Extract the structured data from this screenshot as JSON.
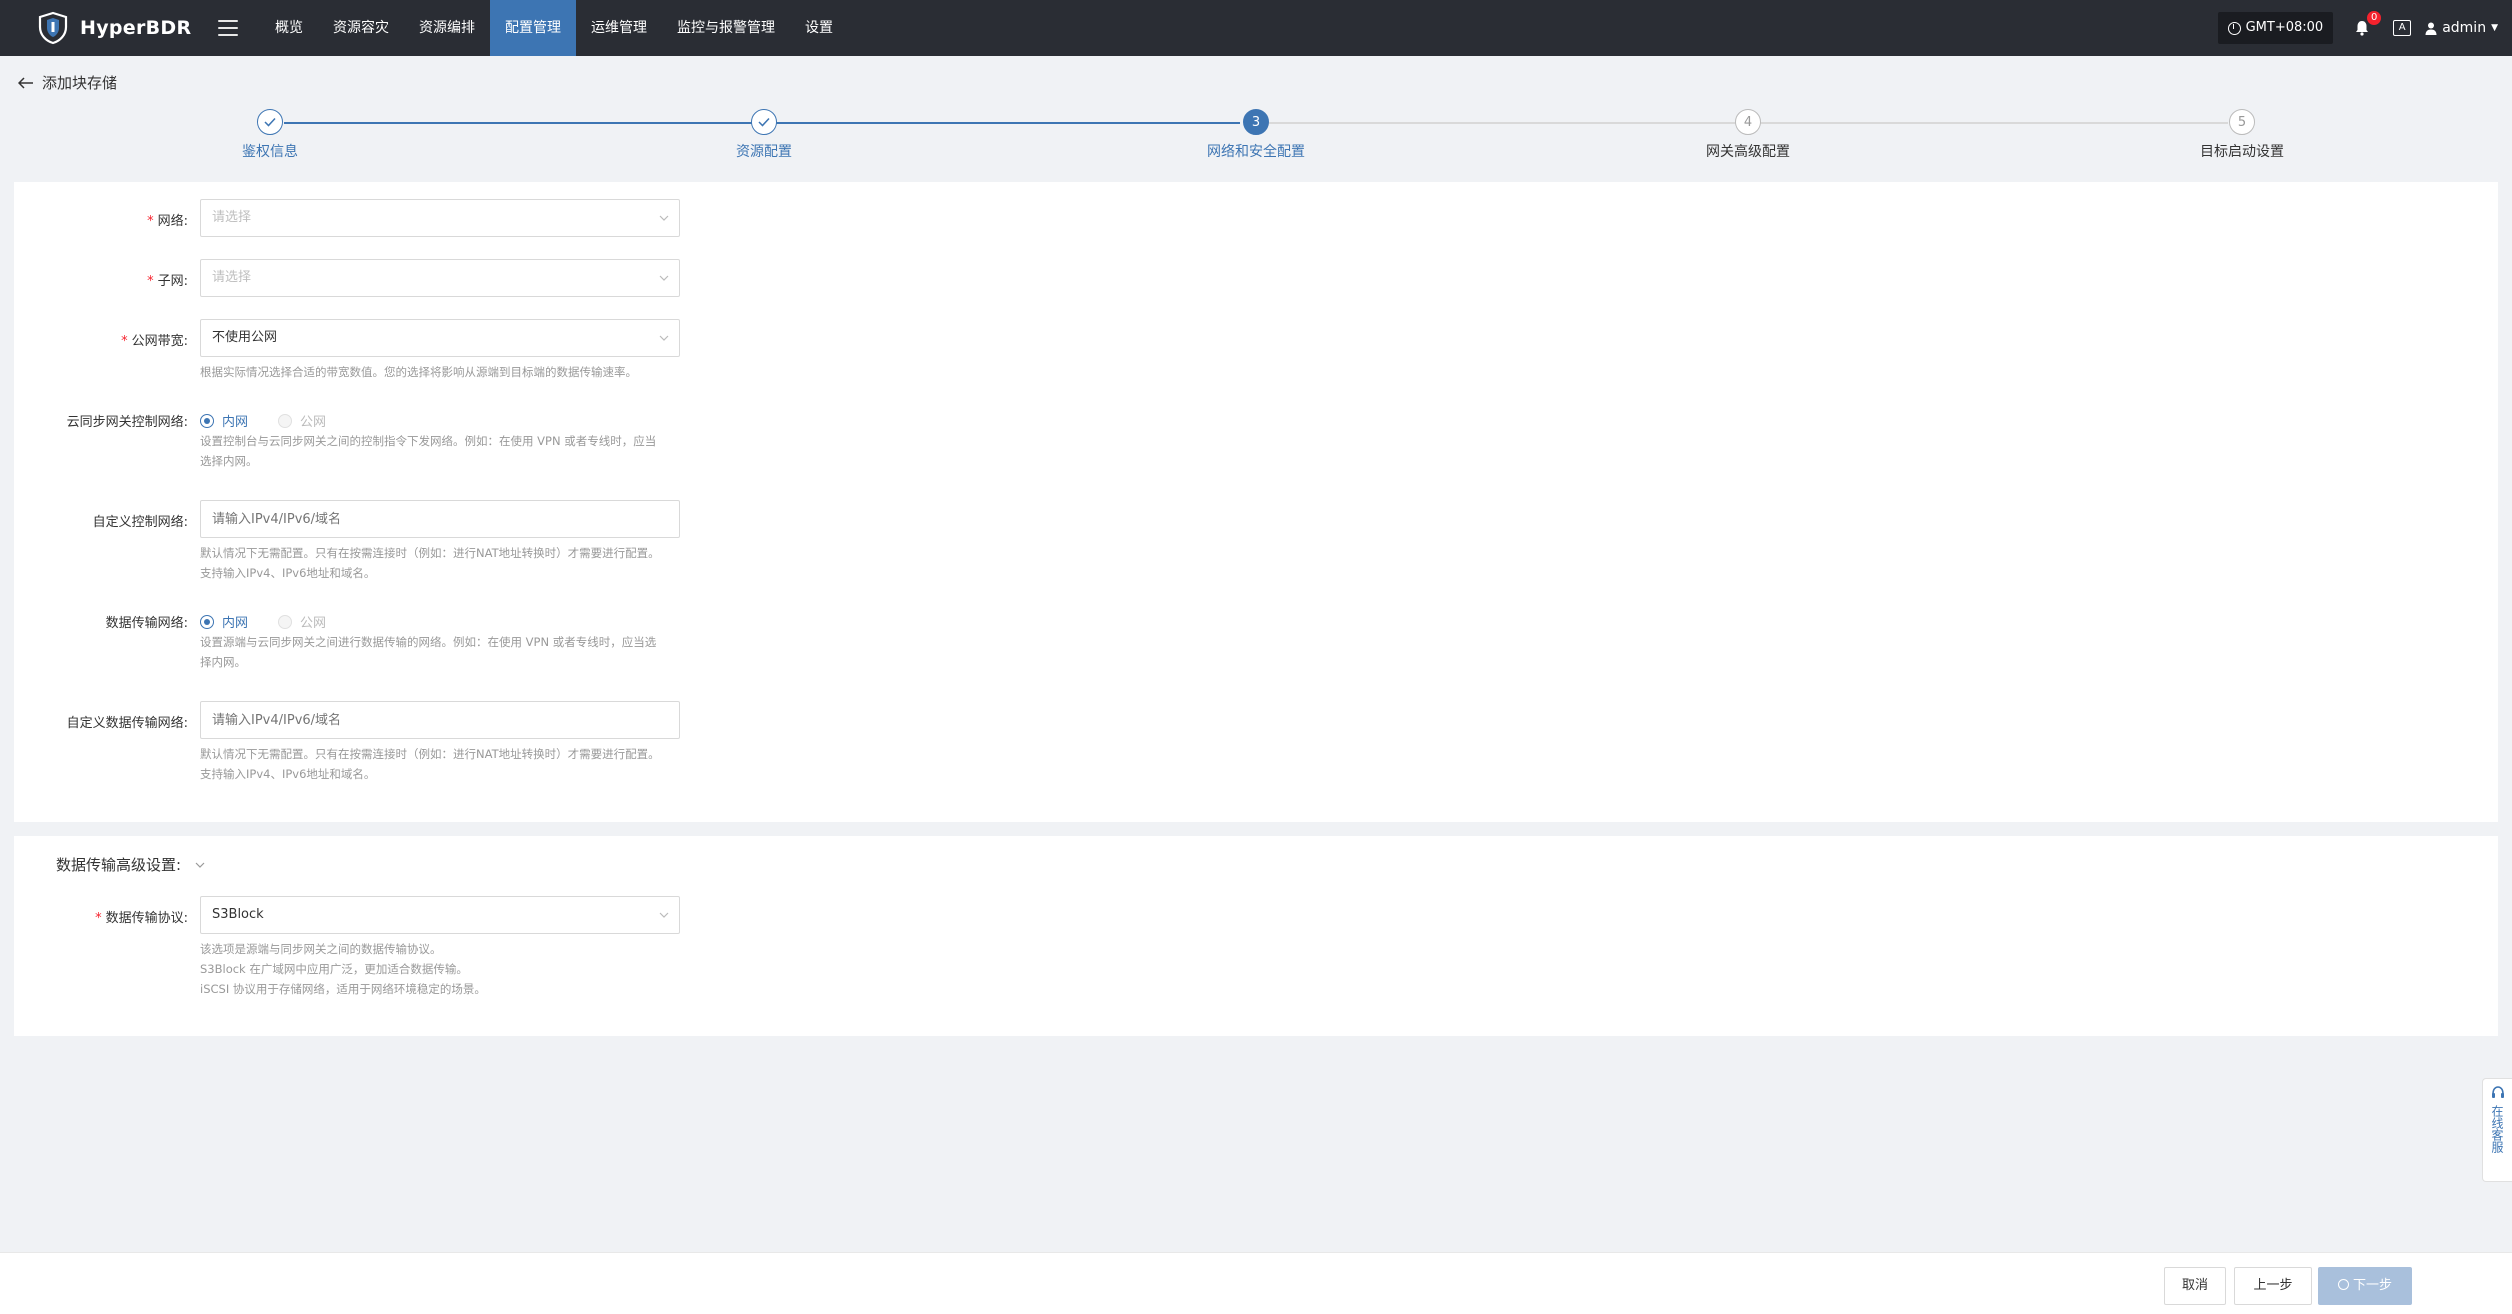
{
  "app": {
    "name": "HyperBDR"
  },
  "nav": {
    "items": [
      "概览",
      "资源容灾",
      "资源编排",
      "配置管理",
      "运维管理",
      "监控与报警管理",
      "设置"
    ],
    "active_index": 3,
    "timezone": "GMT+08:00",
    "notification_count": "0",
    "lang_icon_text": "A",
    "user": "admin"
  },
  "page": {
    "title": "添加块存储"
  },
  "steps": [
    {
      "label": "鉴权信息",
      "status": "done",
      "number": "1"
    },
    {
      "label": "资源配置",
      "status": "done",
      "number": "2"
    },
    {
      "label": "网络和安全配置",
      "status": "current",
      "number": "3"
    },
    {
      "label": "网关高级配置",
      "status": "pending",
      "number": "4"
    },
    {
      "label": "目标启动设置",
      "status": "pending",
      "number": "5"
    }
  ],
  "form": {
    "network": {
      "label": "网络:",
      "placeholder": "请选择"
    },
    "subnet": {
      "label": "子网:",
      "placeholder": "请选择"
    },
    "bandwidth": {
      "label": "公网带宽:",
      "value": "不使用公网",
      "help": "根据实际情况选择合适的带宽数值。您的选择将影响从源端到目标端的数据传输速率。"
    },
    "control_network": {
      "label": "云同步网关控制网络:",
      "options": [
        "内网",
        "公网"
      ],
      "selected": "内网",
      "help_line1": "设置控制台与云同步网关之间的控制指令下发网络。例如：在使用 VPN 或者专线时，应当",
      "help_line2": "选择内网。"
    },
    "custom_control": {
      "label": "自定义控制网络:",
      "placeholder": "请输入IPv4/IPv6/域名",
      "help_line1": "默认情况下无需配置。只有在按需连接时（例如：进行NAT地址转换时）才需要进行配置。",
      "help_line2": "支持输入IPv4、IPv6地址和域名。"
    },
    "data_network": {
      "label": "数据传输网络:",
      "options": [
        "内网",
        "公网"
      ],
      "selected": "内网",
      "help_line1": "设置源端与云同步网关之间进行数据传输的网络。例如：在使用 VPN 或者专线时，应当选",
      "help_line2": "择内网。"
    },
    "custom_data": {
      "label": "自定义数据传输网络:",
      "placeholder": "请输入IPv4/IPv6/域名",
      "help_line1": "默认情况下无需配置。只有在按需连接时（例如：进行NAT地址转换时）才需要进行配置。",
      "help_line2": "支持输入IPv4、IPv6地址和域名。"
    }
  },
  "advanced": {
    "title": "数据传输高级设置:",
    "protocol": {
      "label": "数据传输协议:",
      "value": "S3Block",
      "help_line1": "该选项是源端与同步网关之间的数据传输协议。",
      "help_line2": "S3Block 在广域网中应用广泛，更加适合数据传输。",
      "help_line3": "iSCSI 协议用于存储网络，适用于网络环境稳定的场景。"
    }
  },
  "footer": {
    "cancel": "取消",
    "prev": "上一步",
    "next": "下一步"
  },
  "support": {
    "label": "在线客服"
  },
  "colors": {
    "accent": "#3d75b3",
    "nav_bg": "#2a2d34",
    "required": "#f5222d"
  }
}
